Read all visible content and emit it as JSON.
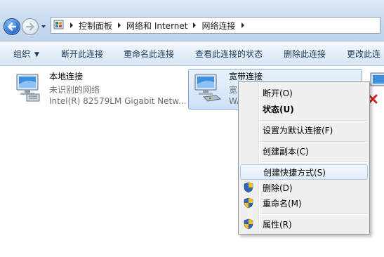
{
  "breadcrumb": {
    "items": [
      "控制面板",
      "网络和 Internet",
      "网络连接"
    ]
  },
  "toolbar": {
    "organize": "组织",
    "disconnect": "断开此连接",
    "rename": "重命名此连接",
    "view_status": "查看此连接的状态",
    "delete": "删除此连接",
    "change": "更改此连"
  },
  "connections": [
    {
      "name": "本地连接",
      "status": "未识别的网络",
      "device": "Intel(R) 82579LM Gigabit Netw..."
    },
    {
      "name": "宽带连接",
      "status_partial": "宽",
      "device_partial": "WA"
    }
  ],
  "context_menu": {
    "items": [
      {
        "label": "断开(O)"
      },
      {
        "label": "状态(U)"
      },
      {
        "label": "设置为默认连接(F)"
      },
      {
        "label": "创建副本(C)"
      },
      {
        "label": "创建快捷方式(S)"
      },
      {
        "label": "删除(D)",
        "icon": "shield-icon"
      },
      {
        "label": "重命名(M)",
        "icon": "shield-icon"
      },
      {
        "label": "属性(R)",
        "icon": "shield-icon"
      }
    ]
  },
  "colors": {
    "accent": "#1c62c9",
    "selection": "#cde1f8",
    "error_x": "#d42121"
  }
}
